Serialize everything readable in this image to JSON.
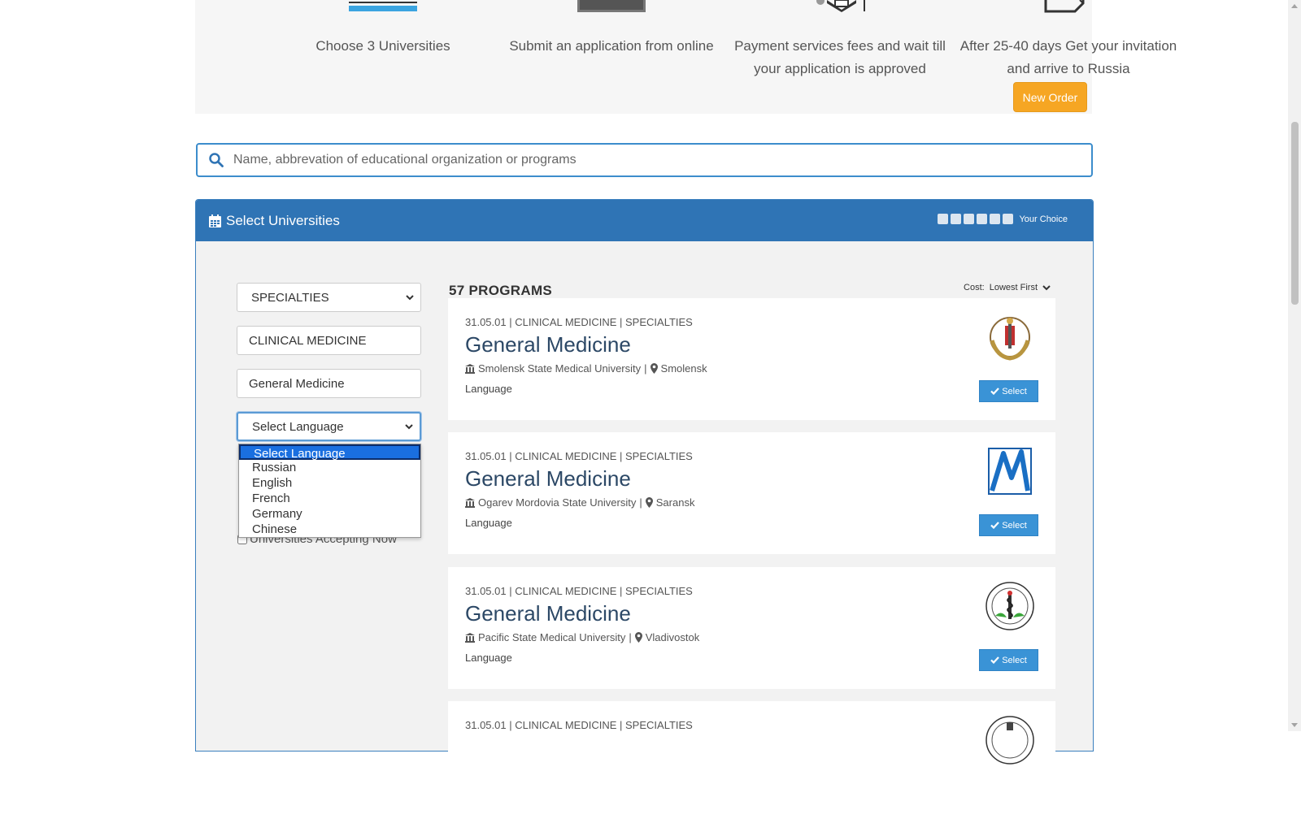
{
  "steps": [
    {
      "text": "Choose 3 Universities",
      "icon": "list-icon"
    },
    {
      "text": "Submit an application from online",
      "icon": "laptop-icon"
    },
    {
      "text": "Payment services fees and wait till your application is approved",
      "icon": "graduation-cap-icon"
    },
    {
      "text": "After 25-40 days Get your invitation and arrive to Russia",
      "icon": "document-icon"
    }
  ],
  "new_order_label": "New Order",
  "search": {
    "placeholder": "Name, abbrevation of educational organization or programs"
  },
  "panel": {
    "title": "Select Universities",
    "choice_label": "Your Choice",
    "choice_slot_count": 6
  },
  "filters": {
    "degree": "SPECIALTIES",
    "field": "CLINICAL MEDICINE",
    "program": "General Medicine",
    "language": "Select Language",
    "language_options": [
      "Select Language",
      "Russian",
      "English",
      "French",
      "Germany",
      "Chinese"
    ],
    "accepting_label": "Universities Accepting Now"
  },
  "results": {
    "count_label": "57 PROGRAMS",
    "sort_label": "Cost:",
    "sort_value": "Lowest First",
    "select_label": "Select",
    "programs": [
      {
        "code": "31.05.01 | CLINICAL MEDICINE | SPECIALTIES",
        "title": "General Medicine",
        "university": "Smolensk State Medical University",
        "city": "Smolensk",
        "language_label": "Language"
      },
      {
        "code": "31.05.01 | CLINICAL MEDICINE | SPECIALTIES",
        "title": "General Medicine",
        "university": "Ogarev Mordovia State University",
        "city": "Saransk",
        "language_label": "Language"
      },
      {
        "code": "31.05.01 | CLINICAL MEDICINE | SPECIALTIES",
        "title": "General Medicine",
        "university": "Pacific State Medical University",
        "city": "Vladivostok",
        "language_label": "Language"
      },
      {
        "code": "31.05.01 | CLINICAL MEDICINE | SPECIALTIES"
      }
    ]
  },
  "colors": {
    "primary": "#2f74b5",
    "accent_orange": "#f6a623",
    "select_button": "#3a93d6"
  }
}
